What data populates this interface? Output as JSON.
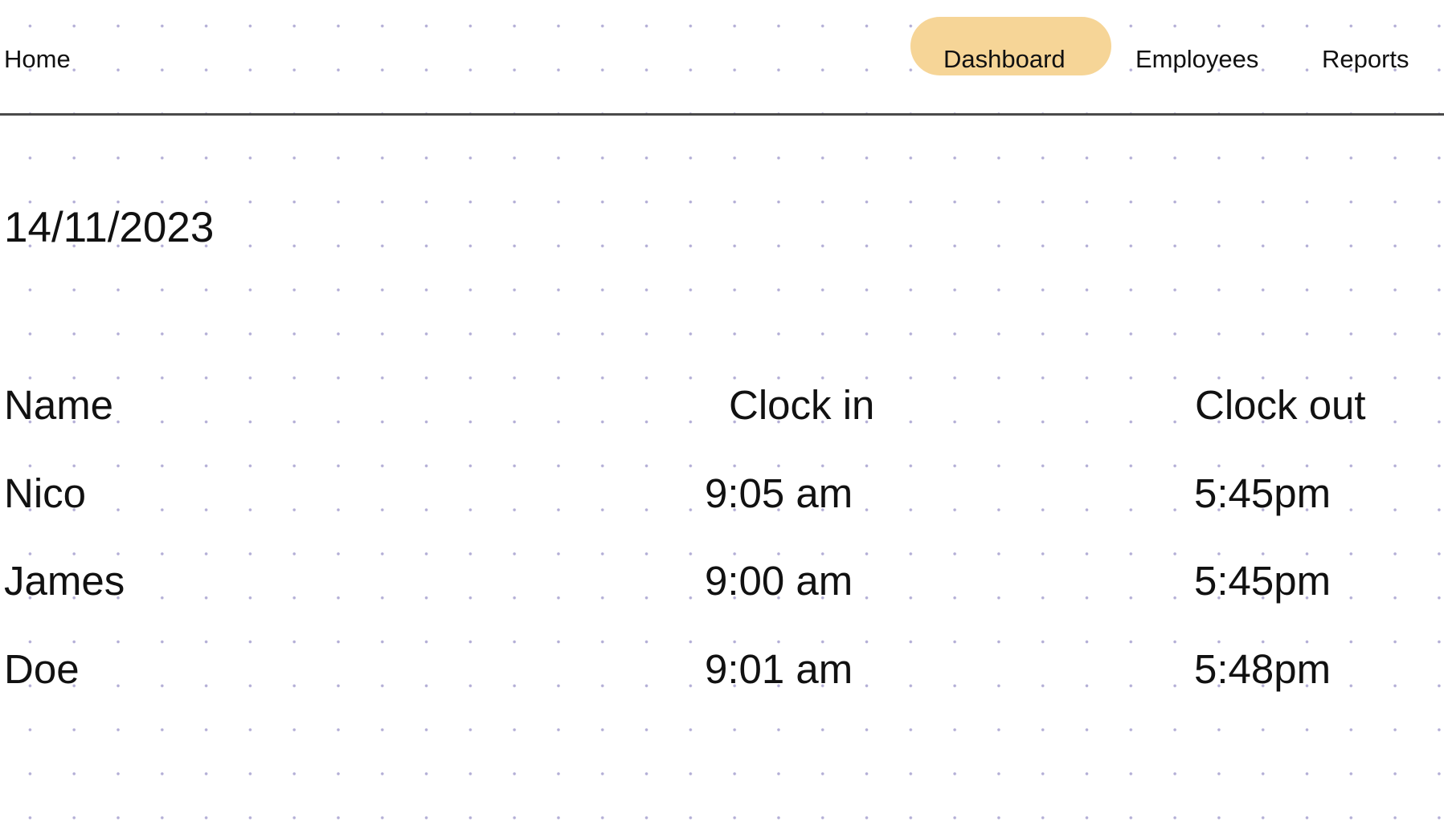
{
  "nav": {
    "home": "Home",
    "dashboard": "Dashboard",
    "employees": "Employees",
    "reports": "Reports",
    "active_color": "#f6d597"
  },
  "date": "14/11/2023",
  "table": {
    "headers": [
      "Name",
      "Clock in",
      "Clock out"
    ],
    "rows": [
      [
        "Nico",
        "9:05 am",
        "5:45pm"
      ],
      [
        "James",
        "9:00 am",
        "5:45pm"
      ],
      [
        "Doe",
        "9:01 am",
        "5:48pm"
      ]
    ]
  }
}
